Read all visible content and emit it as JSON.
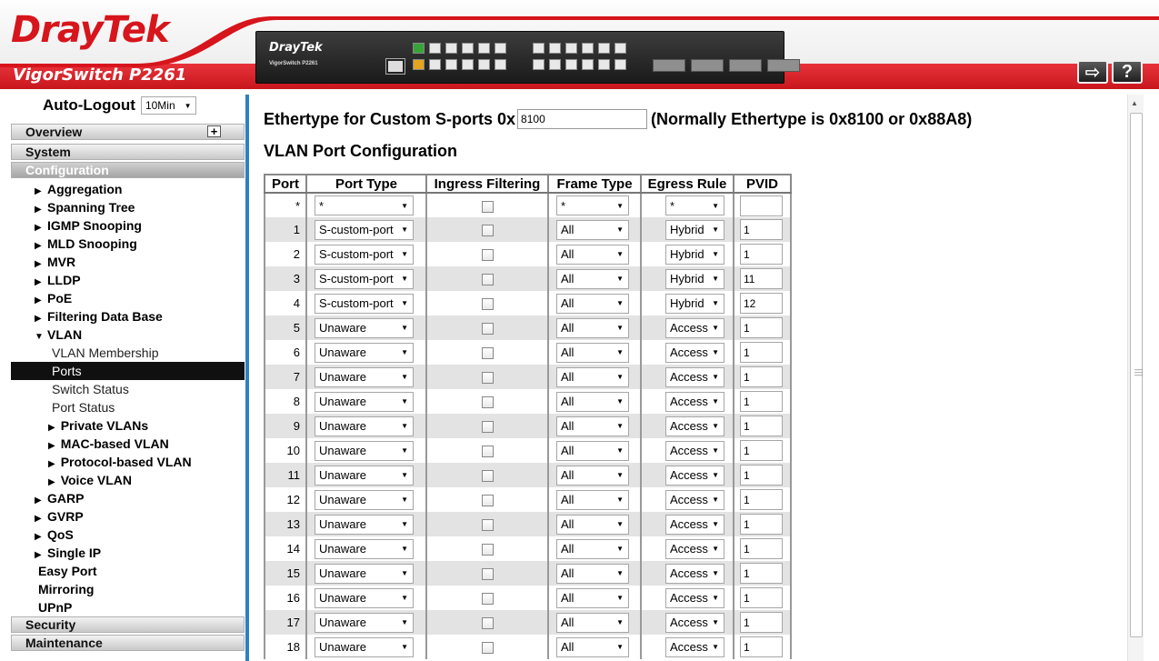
{
  "header": {
    "brand": "DrayTek",
    "model": "VigorSwitch P2261",
    "device_brand": "DrayTek",
    "device_model": "VigorSwitch P2261",
    "logout_icon": "logout-icon",
    "help_label": "?"
  },
  "sidebar": {
    "autologout_label": "Auto-Logout",
    "autologout_value": "10Min",
    "groups": {
      "overview": "Overview",
      "system": "System",
      "configuration": "Configuration",
      "security": "Security",
      "maintenance": "Maintenance"
    },
    "items": {
      "aggregation": "Aggregation",
      "spanning_tree": "Spanning Tree",
      "igmp": "IGMP Snooping",
      "mld": "MLD Snooping",
      "mvr": "MVR",
      "lldp": "LLDP",
      "poe": "PoE",
      "fdb": "Filtering Data Base",
      "vlan": "VLAN",
      "vlan_membership": "VLAN Membership",
      "ports": "Ports",
      "switch_status": "Switch Status",
      "port_status": "Port Status",
      "private_vlans": "Private VLANs",
      "mac_vlan": "MAC-based VLAN",
      "protocol_vlan": "Protocol-based VLAN",
      "voice_vlan": "Voice VLAN",
      "garp": "GARP",
      "gvrp": "GVRP",
      "qos": "QoS",
      "single_ip": "Single IP",
      "easy_port": "Easy Port",
      "mirroring": "Mirroring",
      "upnp": "UPnP"
    }
  },
  "main": {
    "ethertype_label": "Ethertype for Custom S-ports 0x",
    "ethertype_value": "8100",
    "ethertype_note": "(Normally Ethertype is 0x8100 or 0x88A8)",
    "section_title": "VLAN Port Configuration",
    "columns": [
      "Port",
      "Port Type",
      "Ingress Filtering",
      "Frame Type",
      "Egress Rule",
      "PVID"
    ],
    "all_row": {
      "port": "*",
      "type": "*",
      "frame": "*",
      "egress": "*",
      "pvid": ""
    },
    "rows": [
      {
        "port": "1",
        "type": "S-custom-port",
        "frame": "All",
        "egress": "Hybrid",
        "pvid": "1"
      },
      {
        "port": "2",
        "type": "S-custom-port",
        "frame": "All",
        "egress": "Hybrid",
        "pvid": "1"
      },
      {
        "port": "3",
        "type": "S-custom-port",
        "frame": "All",
        "egress": "Hybrid",
        "pvid": "11"
      },
      {
        "port": "4",
        "type": "S-custom-port",
        "frame": "All",
        "egress": "Hybrid",
        "pvid": "12"
      },
      {
        "port": "5",
        "type": "Unaware",
        "frame": "All",
        "egress": "Access",
        "pvid": "1"
      },
      {
        "port": "6",
        "type": "Unaware",
        "frame": "All",
        "egress": "Access",
        "pvid": "1"
      },
      {
        "port": "7",
        "type": "Unaware",
        "frame": "All",
        "egress": "Access",
        "pvid": "1"
      },
      {
        "port": "8",
        "type": "Unaware",
        "frame": "All",
        "egress": "Access",
        "pvid": "1"
      },
      {
        "port": "9",
        "type": "Unaware",
        "frame": "All",
        "egress": "Access",
        "pvid": "1"
      },
      {
        "port": "10",
        "type": "Unaware",
        "frame": "All",
        "egress": "Access",
        "pvid": "1"
      },
      {
        "port": "11",
        "type": "Unaware",
        "frame": "All",
        "egress": "Access",
        "pvid": "1"
      },
      {
        "port": "12",
        "type": "Unaware",
        "frame": "All",
        "egress": "Access",
        "pvid": "1"
      },
      {
        "port": "13",
        "type": "Unaware",
        "frame": "All",
        "egress": "Access",
        "pvid": "1"
      },
      {
        "port": "14",
        "type": "Unaware",
        "frame": "All",
        "egress": "Access",
        "pvid": "1"
      },
      {
        "port": "15",
        "type": "Unaware",
        "frame": "All",
        "egress": "Access",
        "pvid": "1"
      },
      {
        "port": "16",
        "type": "Unaware",
        "frame": "All",
        "egress": "Access",
        "pvid": "1"
      },
      {
        "port": "17",
        "type": "Unaware",
        "frame": "All",
        "egress": "Access",
        "pvid": "1"
      },
      {
        "port": "18",
        "type": "Unaware",
        "frame": "All",
        "egress": "Access",
        "pvid": "1"
      }
    ]
  },
  "colors": {
    "brand_red": "#d7151c",
    "sidebar_divider": "#2f7fc1",
    "selected_bg": "#101010"
  }
}
